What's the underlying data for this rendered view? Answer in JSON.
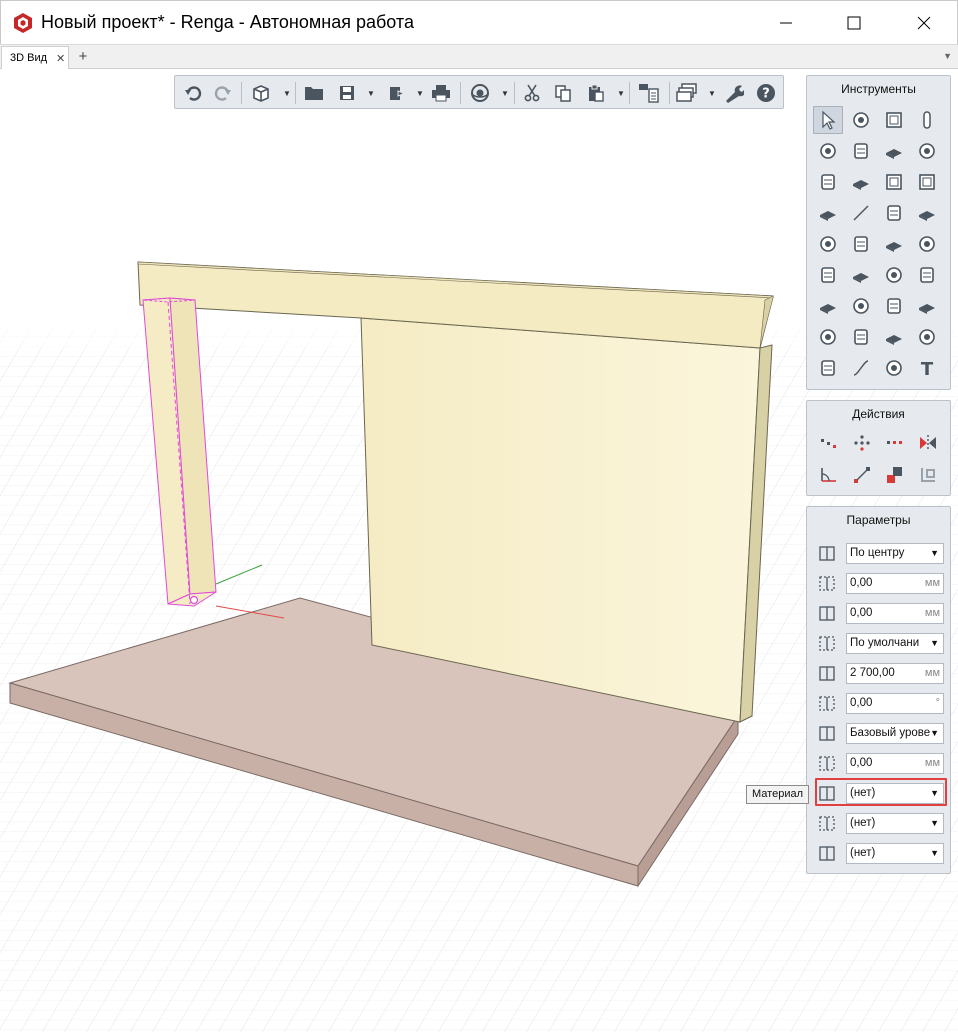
{
  "window": {
    "title": "Новый проект* - Renga - Автономная работа",
    "minimize_icon": "minimize-icon",
    "maximize_icon": "maximize-icon",
    "close_icon": "close-icon"
  },
  "tabs": [
    {
      "label": "3D Вид",
      "close": "✕"
    }
  ],
  "tab_add": "+",
  "toolbar": {
    "buttons": [
      "undo-icon",
      "redo-icon",
      "view-cube-icon",
      "open-folder-icon",
      "save-icon",
      "export-icon",
      "print-icon",
      "orbit-icon",
      "cut-icon",
      "copy-icon",
      "paste-icon",
      "properties-icon",
      "layers-icon",
      "settings-wrench-icon",
      "help-icon"
    ]
  },
  "instruments_panel": {
    "title": "Инструменты"
  },
  "actions_panel": {
    "title": "Действия"
  },
  "parameters_panel": {
    "title": "Параметры",
    "rows": [
      {
        "icon": "alignment-icon",
        "value": "По центру",
        "type": "select"
      },
      {
        "icon": "offset-x-icon",
        "value": "0,00",
        "unit": "мм",
        "type": "input"
      },
      {
        "icon": "offset-y-icon",
        "value": "0,00",
        "unit": "мм",
        "type": "input"
      },
      {
        "icon": "profile-icon",
        "value": "По умолчани",
        "type": "select"
      },
      {
        "icon": "height-icon",
        "value": "2 700,00",
        "unit": "мм",
        "type": "input"
      },
      {
        "icon": "rotation-icon",
        "value": "0,00",
        "unit": "°",
        "type": "input"
      },
      {
        "icon": "level-icon",
        "value": "Базовый урове",
        "type": "select"
      },
      {
        "icon": "level-offset-icon",
        "value": "0,00",
        "unit": "мм",
        "type": "input"
      },
      {
        "icon": "material-icon",
        "value": "(нет)",
        "type": "select"
      },
      {
        "icon": "hatch-icon",
        "value": "(нет)",
        "type": "select"
      },
      {
        "icon": "mark-icon",
        "value": "(нет)",
        "type": "select"
      }
    ]
  },
  "tooltip": "Материал",
  "colors": {
    "panel_bg": "#e6e9ed",
    "selection": "#e04ad8",
    "wall": "#f7efc8",
    "slab": "#d9c3bb",
    "highlight": "#e0403f"
  }
}
